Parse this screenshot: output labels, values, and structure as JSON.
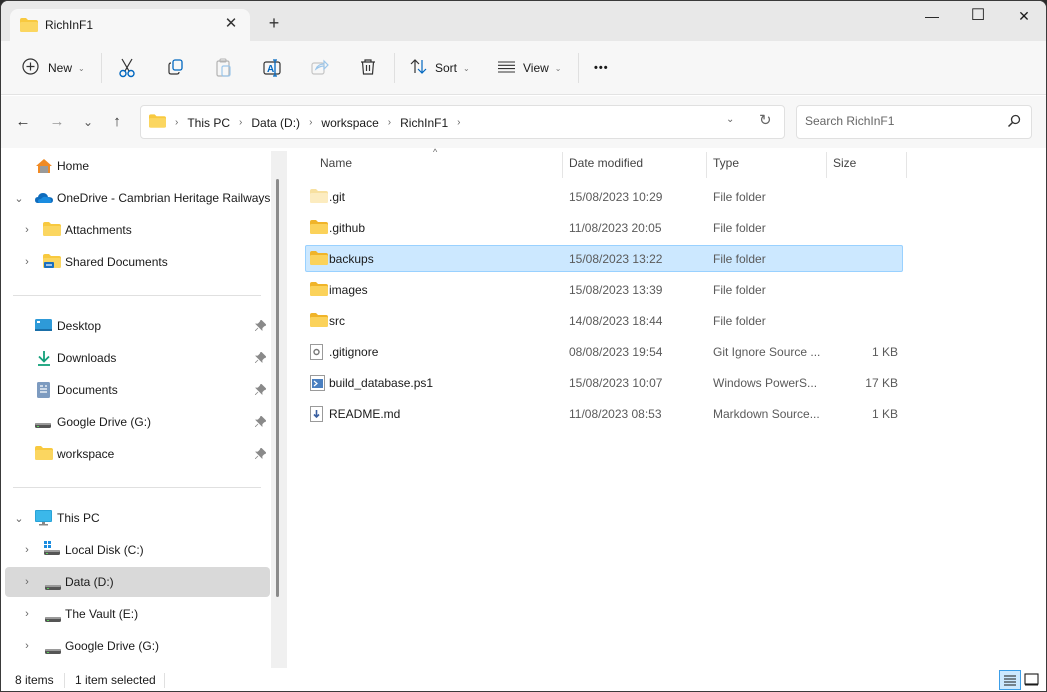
{
  "window": {
    "tab_title": "RichInF1",
    "new_tab_label": "+",
    "close_tab_label": "✕",
    "controls": {
      "minimize": "—",
      "maximize": "☐",
      "close": "✕"
    }
  },
  "toolbar": {
    "new_label": "New",
    "sort_label": "Sort",
    "view_label": "View",
    "more_label": "•••",
    "icons": [
      "cut-icon",
      "copy-icon",
      "paste-icon",
      "rename-icon",
      "share-icon",
      "delete-icon"
    ]
  },
  "nav": {
    "back": "←",
    "forward": "→",
    "recent": "⌄",
    "up": "↑",
    "breadcrumb": [
      "This PC",
      "Data (D:)",
      "workspace",
      "RichInF1"
    ],
    "search_placeholder": "Search RichInF1"
  },
  "sidebar": {
    "quick": [
      {
        "label": "Home",
        "icon": "home-icon"
      },
      {
        "label": "OneDrive - Cambrian Heritage Railways",
        "icon": "onedrive-icon",
        "expanded": true
      },
      {
        "label": "Attachments",
        "icon": "folder-icon",
        "expanded": false
      },
      {
        "label": "Shared Documents",
        "icon": "shared-folder-icon",
        "expanded": false
      }
    ],
    "pinned": [
      {
        "label": "Desktop",
        "icon": "desktop-icon"
      },
      {
        "label": "Downloads",
        "icon": "download-icon"
      },
      {
        "label": "Documents",
        "icon": "documents-icon"
      },
      {
        "label": "Google Drive (G:)",
        "icon": "drive-icon"
      },
      {
        "label": "workspace",
        "icon": "folder-icon"
      }
    ],
    "this_pc": {
      "label": "This PC",
      "icon": "computer-icon",
      "expanded": true
    },
    "drives": [
      {
        "label": "Local Disk (C:)",
        "icon": "windows-drive-icon"
      },
      {
        "label": "Data (D:)",
        "icon": "drive-icon",
        "selected": true
      },
      {
        "label": "The Vault (E:)",
        "icon": "drive-icon"
      },
      {
        "label": "Google Drive (G:)",
        "icon": "drive-icon"
      }
    ]
  },
  "files": {
    "columns": [
      "Name",
      "Date modified",
      "Type",
      "Size"
    ],
    "sort_column": "Name",
    "rows": [
      {
        "name": ".git",
        "date": "15/08/2023 10:29",
        "type": "File folder",
        "size": "",
        "icon": "folder-light-icon"
      },
      {
        "name": ".github",
        "date": "11/08/2023 20:05",
        "type": "File folder",
        "size": "",
        "icon": "folder-icon"
      },
      {
        "name": "backups",
        "date": "15/08/2023 13:22",
        "type": "File folder",
        "size": "",
        "icon": "folder-icon",
        "selected": true
      },
      {
        "name": "images",
        "date": "15/08/2023 13:39",
        "type": "File folder",
        "size": "",
        "icon": "folder-icon"
      },
      {
        "name": "src",
        "date": "14/08/2023 18:44",
        "type": "File folder",
        "size": "",
        "icon": "folder-icon"
      },
      {
        "name": ".gitignore",
        "date": "08/08/2023 19:54",
        "type": "Git Ignore Source ...",
        "size": "1 KB",
        "icon": "config-file-icon"
      },
      {
        "name": "build_database.ps1",
        "date": "15/08/2023 10:07",
        "type": "Windows PowerS...",
        "size": "17 KB",
        "icon": "powershell-file-icon"
      },
      {
        "name": "README.md",
        "date": "11/08/2023 08:53",
        "type": "Markdown Source...",
        "size": "1 KB",
        "icon": "markdown-file-icon"
      }
    ]
  },
  "status": {
    "item_count": "8 items",
    "selection": "1 item selected"
  },
  "colors": {
    "selection_bg": "#cce8ff",
    "selection_border": "#99d1ff",
    "accent": "#0067c0",
    "folder": "#f8c93f"
  }
}
